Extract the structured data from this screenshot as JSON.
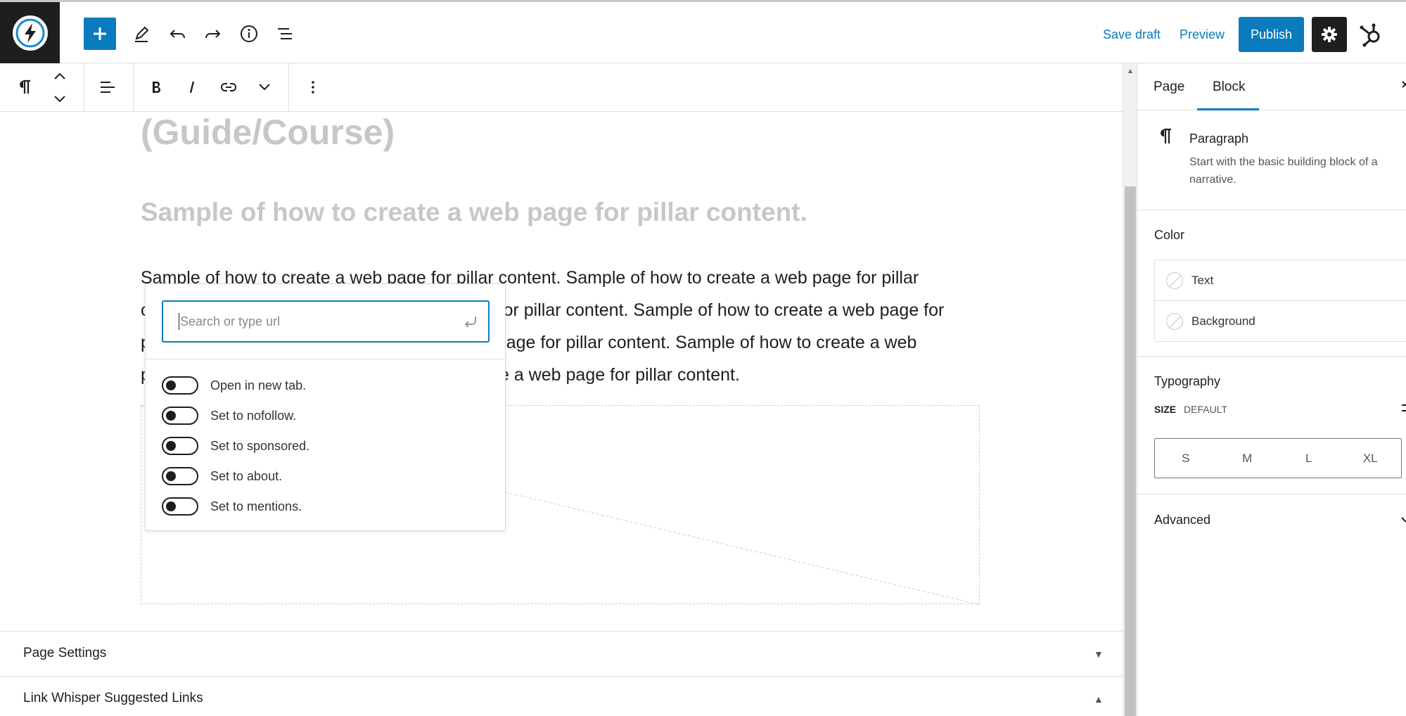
{
  "header": {
    "save_draft": "Save draft",
    "preview": "Preview",
    "publish": "Publish"
  },
  "editor": {
    "heading_course": "(Guide/Course)",
    "heading_sample": "Sample of how to create a web page for pillar content.",
    "paragraph_lines": [
      "Sample of how to create a web page for pillar content. Sample of how to create a web page for pillar",
      "content. Sample of how to create a web page for pillar content. Sample of how to create a web page for",
      "pillar content. Sample of how to create a web page for pillar content. Sample of how to create a web",
      "page for pillar content. Sample of how to create a web page for pillar content."
    ]
  },
  "link_popover": {
    "placeholder": "Search or type url",
    "toggles": [
      {
        "label": "Open in new tab.",
        "on": false
      },
      {
        "label": "Set to nofollow.",
        "on": false
      },
      {
        "label": "Set to sponsored.",
        "on": false
      },
      {
        "label": "Set to about.",
        "on": false
      },
      {
        "label": "Set to mentions.",
        "on": false
      }
    ]
  },
  "meta_boxes": [
    {
      "title": "Page Settings",
      "arrow": "▼"
    },
    {
      "title": "Link Whisper Suggested Links",
      "arrow": "▲"
    }
  ],
  "sidebar": {
    "tabs": [
      {
        "label": "Page",
        "active": false
      },
      {
        "label": "Block",
        "active": true
      }
    ],
    "block": {
      "title": "Paragraph",
      "description_lines": [
        "Start with the basic building block of a",
        "narrative."
      ]
    },
    "color": {
      "heading": "Color",
      "items": [
        "Text",
        "Background"
      ]
    },
    "typography": {
      "heading": "Typography",
      "size_label": "SIZE",
      "size_value": "DEFAULT",
      "sizes": [
        "S",
        "M",
        "L",
        "XL"
      ]
    },
    "advanced": {
      "heading": "Advanced"
    }
  },
  "colors": {
    "accent": "#0a7bbd",
    "dark": "#1e1e1e",
    "muted_heading": "#c7c7c7"
  }
}
